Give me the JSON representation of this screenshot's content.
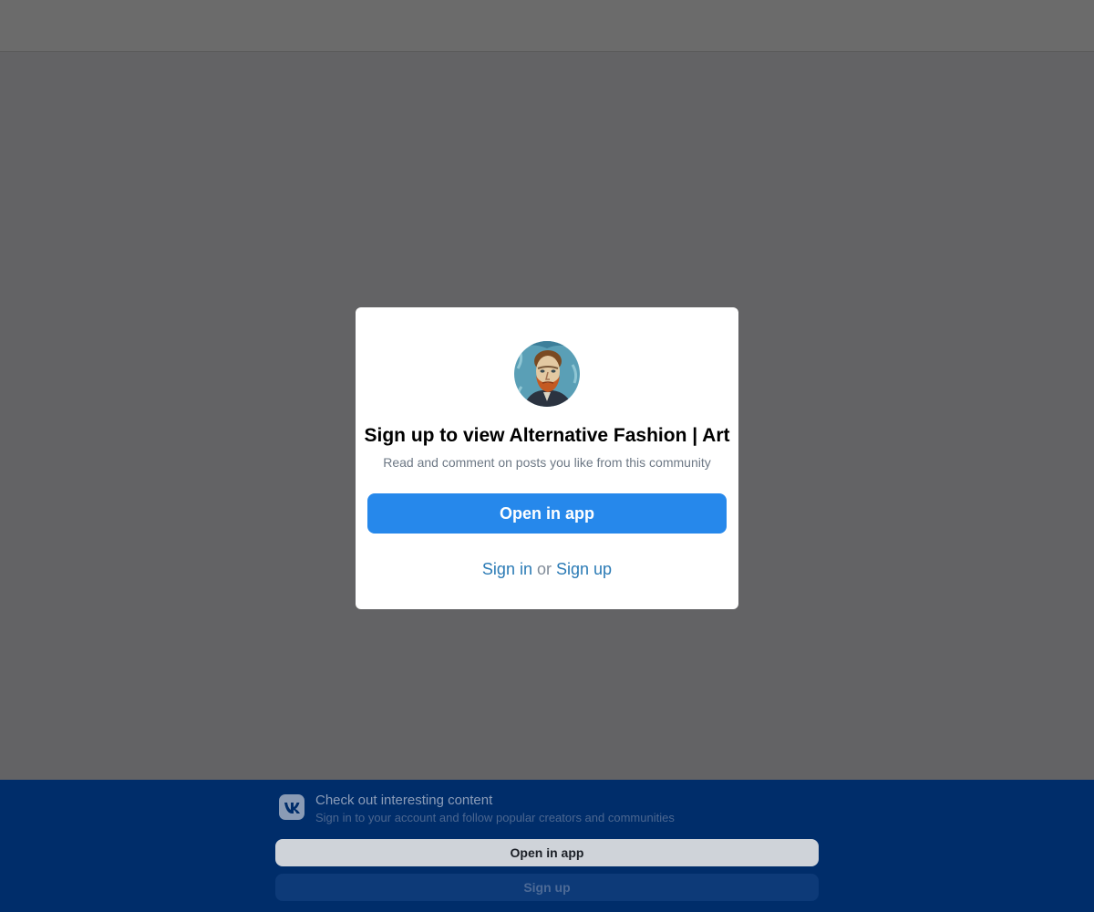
{
  "modal": {
    "avatar_icon": "community-avatar-portrait",
    "title": "Sign up to view Alternative Fashion | Art",
    "subtitle": "Read and comment on posts you like from this community",
    "open_app_label": "Open in app",
    "sign_in_label": "Sign in",
    "or_label": "or",
    "sign_up_label": "Sign up"
  },
  "banner": {
    "logo_icon": "vk-logo-icon",
    "title": "Check out interesting content",
    "subtitle": "Sign in to your account and follow popular creators and communities",
    "open_app_label": "Open in app",
    "sign_up_label": "Sign up"
  },
  "colors": {
    "primary_button": "#2688eb",
    "link": "#2a7ab5",
    "banner_background": "#002d6a",
    "overlay": "rgba(0,0,0,0.58)"
  }
}
